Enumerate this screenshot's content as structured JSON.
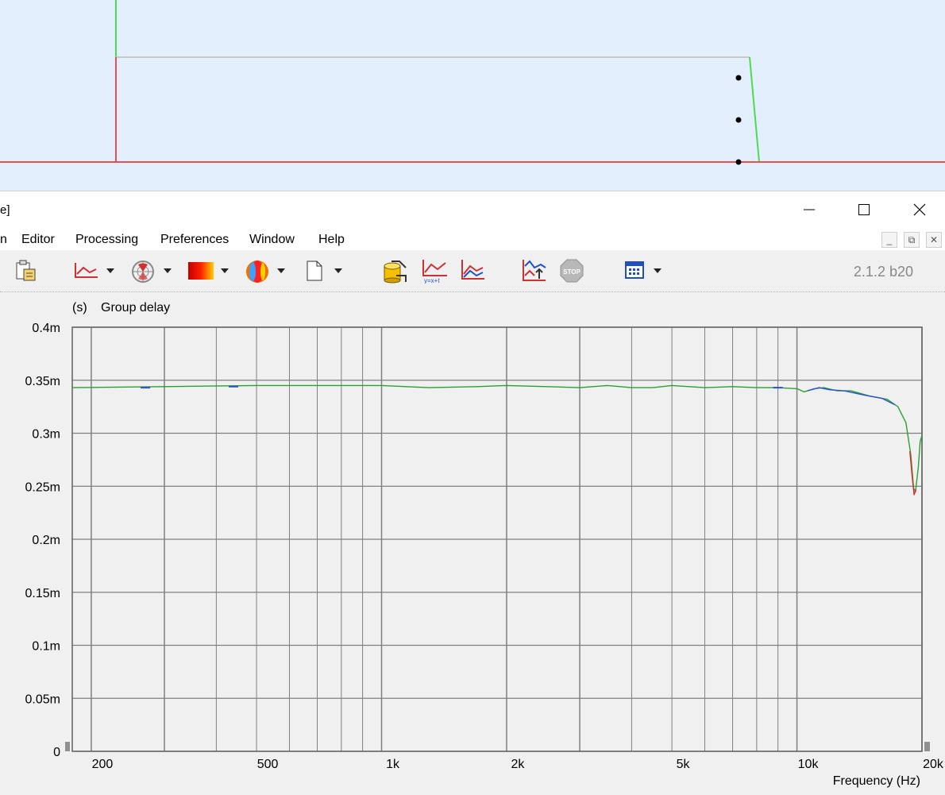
{
  "window": {
    "title_fragment": "e]",
    "version": "2.1.2 b20"
  },
  "menu": [
    "n",
    "Editor",
    "Processing",
    "Preferences",
    "Window",
    "Help"
  ],
  "toolbar_icons": [
    "clipboard-icon",
    "graph-icon",
    "polar-icon",
    "heatmap-icon",
    "balloon-icon",
    "blank-page-icon",
    "cylinder-icon",
    "graph-formula-icon",
    "graph-overlay-icon",
    "graph-export-icon",
    "stop-icon",
    "calendar-grid-icon"
  ],
  "colors": {
    "plot_bg": "#f0f0f0",
    "grid_major": "#808080",
    "grid_minor": "#b0b0b0",
    "trace_green": "#2aa030",
    "trace_blue": "#2c50d0",
    "trace_red": "#d03030",
    "preview_bg": "#e3effc"
  },
  "chart_data": {
    "type": "line",
    "title": "Group delay",
    "ylabel": "(s)",
    "xlabel": "Frequency  (Hz)",
    "xscale": "log",
    "xlim": [
      180,
      20000
    ],
    "ylim": [
      0,
      0.0004
    ],
    "grid": true,
    "y_ticks": [
      {
        "v": 0,
        "label": "0"
      },
      {
        "v": 5e-05,
        "label": "0.05m"
      },
      {
        "v": 0.0001,
        "label": "0.1m"
      },
      {
        "v": 0.00015,
        "label": "0.15m"
      },
      {
        "v": 0.0002,
        "label": "0.2m"
      },
      {
        "v": 0.00025,
        "label": "0.25m"
      },
      {
        "v": 0.0003,
        "label": "0.3m"
      },
      {
        "v": 0.00035,
        "label": "0.35m"
      },
      {
        "v": 0.0004,
        "label": "0.4m"
      }
    ],
    "x_ticks": [
      {
        "v": 200,
        "label": "200"
      },
      {
        "v": 500,
        "label": "500"
      },
      {
        "v": 1000,
        "label": "1k"
      },
      {
        "v": 2000,
        "label": "2k"
      },
      {
        "v": 5000,
        "label": "5k"
      },
      {
        "v": 10000,
        "label": "10k"
      },
      {
        "v": 20000,
        "label": "20k"
      }
    ],
    "series": [
      {
        "color": "#2aa030",
        "points": [
          [
            180,
            0.000343
          ],
          [
            300,
            0.000344
          ],
          [
            500,
            0.000345
          ],
          [
            800,
            0.000345
          ],
          [
            1000,
            0.000345
          ],
          [
            1300,
            0.000343
          ],
          [
            1700,
            0.000344
          ],
          [
            2000,
            0.000345
          ],
          [
            2500,
            0.000344
          ],
          [
            3000,
            0.000343
          ],
          [
            3500,
            0.000345
          ],
          [
            4000,
            0.000343
          ],
          [
            4500,
            0.000343
          ],
          [
            5000,
            0.000345
          ],
          [
            6000,
            0.000343
          ],
          [
            7000,
            0.000344
          ],
          [
            8000,
            0.000343
          ],
          [
            9000,
            0.000343
          ],
          [
            10000,
            0.000342
          ],
          [
            10400,
            0.000339
          ],
          [
            11000,
            0.000342
          ],
          [
            11600,
            0.000343
          ],
          [
            12500,
            0.00034
          ],
          [
            13500,
            0.00034
          ],
          [
            15000,
            0.000335
          ],
          [
            16500,
            0.000332
          ],
          [
            17500,
            0.000325
          ],
          [
            18300,
            0.00031
          ],
          [
            18800,
            0.00028
          ],
          [
            19100,
            0.000248
          ],
          [
            19300,
            0.000245
          ],
          [
            19600,
            0.000268
          ],
          [
            19800,
            0.000292
          ],
          [
            20000,
            0.000298
          ]
        ]
      },
      {
        "color": "#2c50d0",
        "points": [
          [
            10600,
            0.00034
          ],
          [
            11300,
            0.000343
          ],
          [
            12000,
            0.000341
          ],
          [
            13000,
            0.00034
          ],
          [
            14500,
            0.000336
          ],
          [
            16000,
            0.000333
          ],
          [
            17200,
            0.000327
          ]
        ]
      },
      {
        "color": "#d03030",
        "points": [
          [
            18700,
            0.000283
          ],
          [
            18950,
            0.000258
          ],
          [
            19150,
            0.000242
          ],
          [
            19350,
            0.000247
          ]
        ]
      }
    ]
  }
}
